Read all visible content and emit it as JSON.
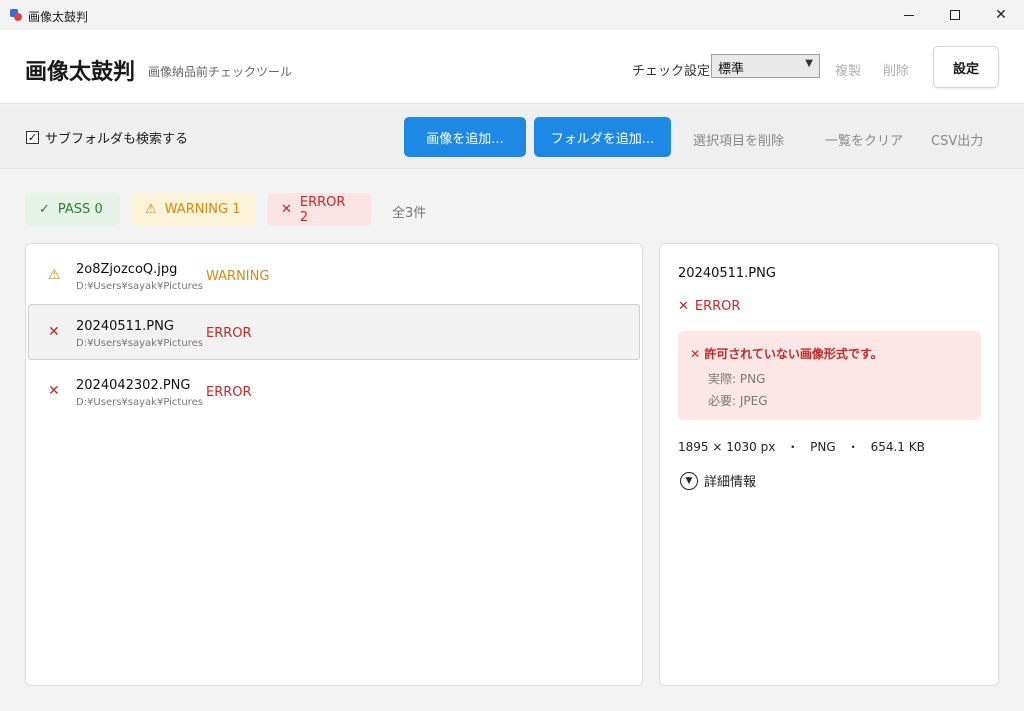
{
  "window": {
    "title": "画像太鼓判",
    "minimize_icon": "minimize-icon",
    "maximize_icon": "maximize-icon",
    "close_glyph": "✕"
  },
  "header": {
    "title": "画像太鼓判",
    "subtitle": "画像納品前チェックツール",
    "check_setting_label": "チェック設定:",
    "check_setting_value": "標準",
    "copy_label": "複製",
    "delete_label": "削除",
    "settings_label": "設定"
  },
  "toolbar": {
    "include_subfolders_checked": true,
    "include_subfolders_label": "サブフォルダも検索する",
    "add_image_label": "画像を追加...",
    "add_folder_label": "フォルダを追加...",
    "remove_selected_label": "選択項目を削除",
    "clear_list_label": "一覧をクリア",
    "csv_export_label": "CSV出力"
  },
  "filters": {
    "pass": {
      "icon": "✓",
      "label": "PASS 0"
    },
    "warning": {
      "icon": "⚠",
      "label": "WARNING 1"
    },
    "error": {
      "icon": "✕",
      "label": "ERROR 2"
    },
    "total_label": "全3件"
  },
  "files": [
    {
      "icon": "⚠",
      "name": "2o8ZjozcoQ.jpg",
      "path": "D:¥Users¥sayak¥Pictures",
      "status": "WARNING"
    },
    {
      "icon": "✕",
      "name": "20240511.PNG",
      "path": "D:¥Users¥sayak¥Pictures",
      "status": "ERROR"
    },
    {
      "icon": "✕",
      "name": "2024042302.PNG",
      "path": "D:¥Users¥sayak¥Pictures",
      "status": "ERROR"
    }
  ],
  "colors": {
    "accent": "#1e88e5",
    "pass": "#2e7d32",
    "warning": "#d68910",
    "error": "#c62828"
  },
  "detail": {
    "filename": "20240511.PNG",
    "status_icon": "✕",
    "status": "ERROR",
    "error_title": "✕ 許可されていない画像形式です。",
    "actual": "実際: PNG",
    "required": "必要: JPEG",
    "meta": "1895 × 1030 px   ・   PNG   ・   654.1 KB",
    "details_label": "詳細情報"
  }
}
